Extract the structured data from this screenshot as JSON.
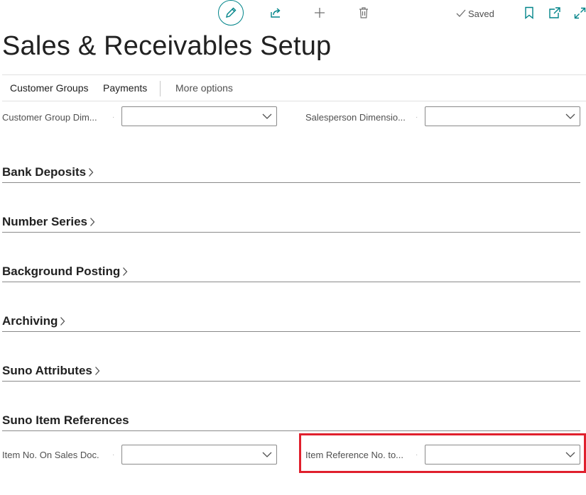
{
  "toolbar": {
    "saved_label": "Saved",
    "accent_color": "#008489"
  },
  "page": {
    "title": "Sales & Receivables Setup"
  },
  "actions": {
    "customer_groups": "Customer Groups",
    "payments": "Payments",
    "more_options": "More options"
  },
  "fields_top": {
    "customer_group_dim_label": "Customer Group Dim...",
    "customer_group_dim_value": "",
    "salesperson_dim_label": "Salesperson Dimensio...",
    "salesperson_dim_value": ""
  },
  "sections": {
    "bank_deposits": "Bank Deposits",
    "number_series": "Number Series",
    "background_posting": "Background Posting",
    "archiving": "Archiving",
    "suno_attributes": "Suno Attributes",
    "suno_item_references": "Suno Item References"
  },
  "fields_bottom": {
    "item_no_label": "Item No. On Sales Doc.",
    "item_no_value": "",
    "item_ref_label": "Item Reference No. to...",
    "item_ref_value": ""
  },
  "highlight_color": "#e0202d"
}
